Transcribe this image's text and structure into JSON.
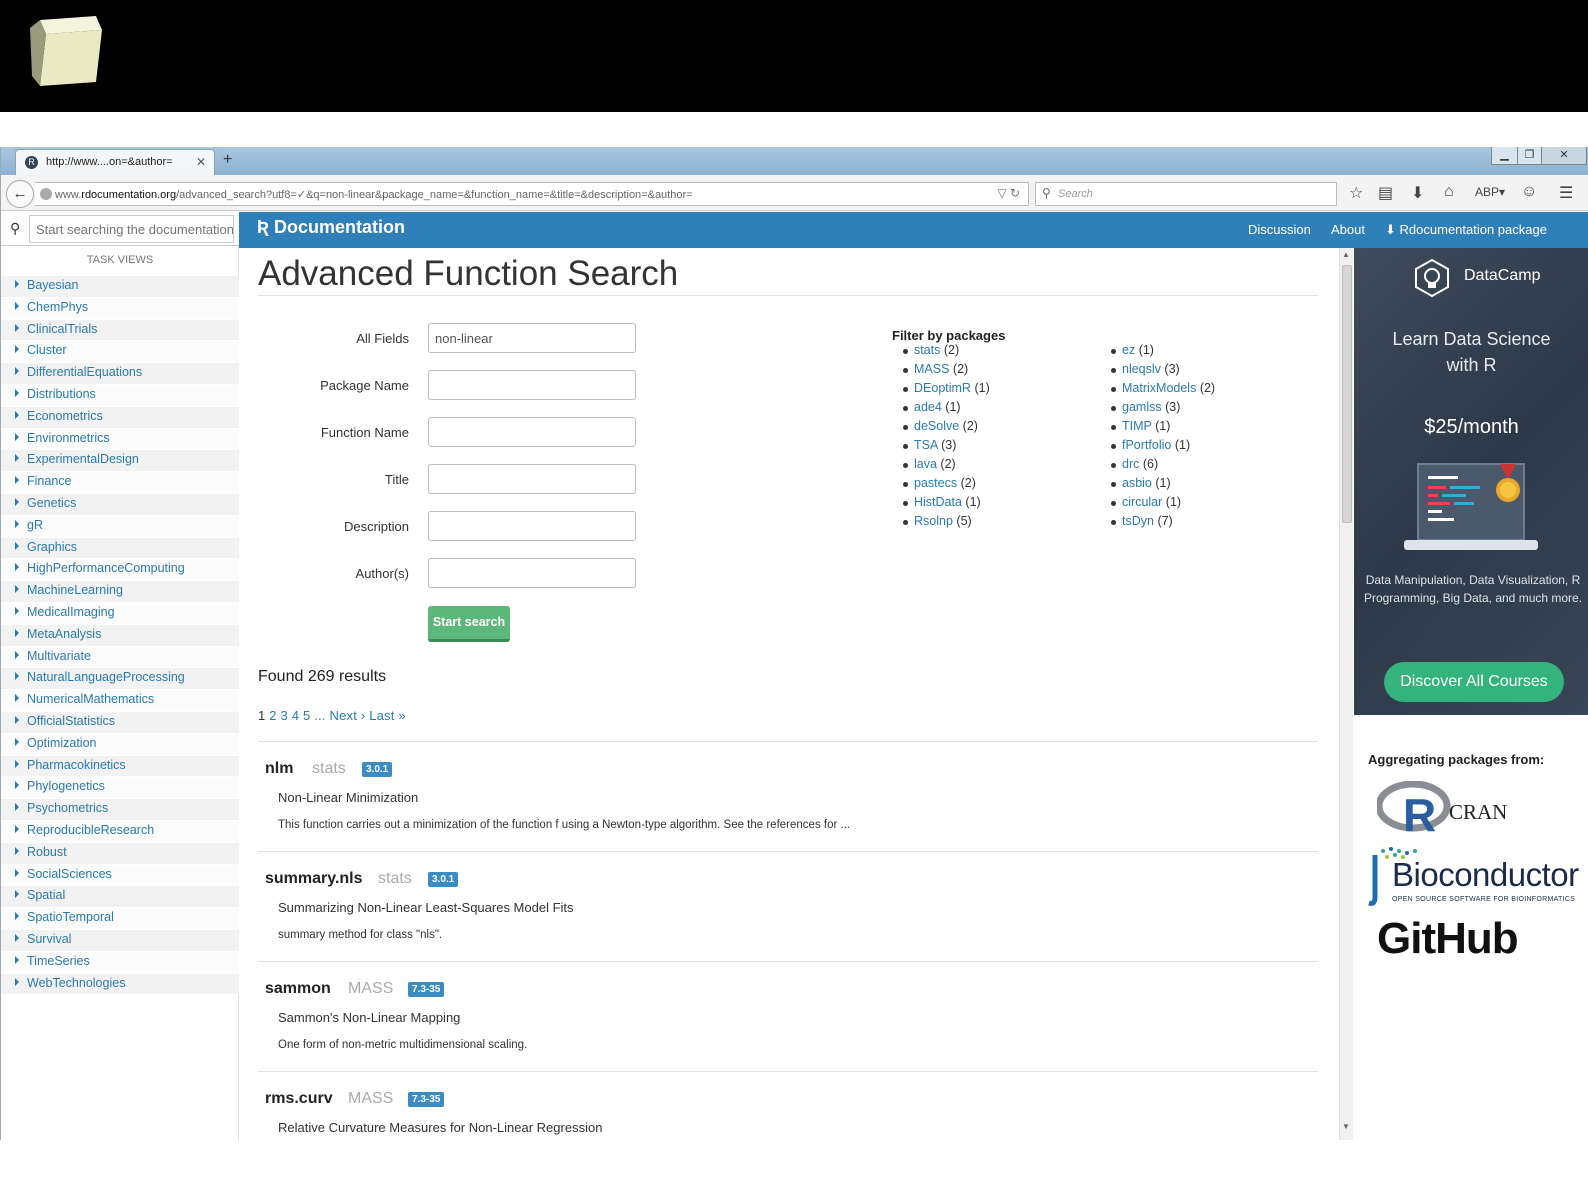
{
  "browser": {
    "tab_title": "http://www....on=&author=",
    "url_domain": "www.rdocumentation.org",
    "url_prefix": "www.",
    "url_domain_main": "rdocumentation.org",
    "url_path": "/advanced_search?utf8=✓&q=non-linear&package_name=&function_name=&title=&description=&author=",
    "search_placeholder": "Search"
  },
  "sidebar": {
    "search_placeholder": "Start searching the documentation",
    "heading": "TASK VIEWS",
    "items": [
      "Bayesian",
      "ChemPhys",
      "ClinicalTrials",
      "Cluster",
      "DifferentialEquations",
      "Distributions",
      "Econometrics",
      "Environmetrics",
      "ExperimentalDesign",
      "Finance",
      "Genetics",
      "gR",
      "Graphics",
      "HighPerformanceComputing",
      "MachineLearning",
      "MedicalImaging",
      "MetaAnalysis",
      "Multivariate",
      "NaturalLanguageProcessing",
      "NumericalMathematics",
      "OfficialStatistics",
      "Optimization",
      "Pharmacokinetics",
      "Phylogenetics",
      "Psychometrics",
      "ReproducibleResearch",
      "Robust",
      "SocialSciences",
      "Spatial",
      "SpatioTemporal",
      "Survival",
      "TimeSeries",
      "WebTechnologies"
    ]
  },
  "header": {
    "logo_text": "Documentation",
    "nav": {
      "discussion": "Discussion",
      "about": "About",
      "package": "Rdocumentation package"
    }
  },
  "form": {
    "title": "Advanced Function Search",
    "fields": [
      {
        "label": "All Fields",
        "value": "non-linear"
      },
      {
        "label": "Package Name",
        "value": ""
      },
      {
        "label": "Function Name",
        "value": ""
      },
      {
        "label": "Title",
        "value": ""
      },
      {
        "label": "Description",
        "value": ""
      },
      {
        "label": "Author(s)",
        "value": ""
      }
    ],
    "submit": "Start search"
  },
  "filter": {
    "heading": "Filter by packages",
    "col1": [
      {
        "name": "stats",
        "count": "(2)"
      },
      {
        "name": "MASS",
        "count": "(2)"
      },
      {
        "name": "DEoptimR",
        "count": "(1)"
      },
      {
        "name": "ade4",
        "count": "(1)"
      },
      {
        "name": "deSolve",
        "count": "(2)"
      },
      {
        "name": "TSA",
        "count": "(3)"
      },
      {
        "name": "lava",
        "count": "(2)"
      },
      {
        "name": "pastecs",
        "count": "(2)"
      },
      {
        "name": "HistData",
        "count": "(1)"
      },
      {
        "name": "Rsolnp",
        "count": "(5)"
      }
    ],
    "col2": [
      {
        "name": "ez",
        "count": "(1)"
      },
      {
        "name": "nleqslv",
        "count": "(3)"
      },
      {
        "name": "MatrixModels",
        "count": "(2)"
      },
      {
        "name": "gamlss",
        "count": "(3)"
      },
      {
        "name": "TIMP",
        "count": "(1)"
      },
      {
        "name": "fPortfolio",
        "count": "(1)"
      },
      {
        "name": "drc",
        "count": "(6)"
      },
      {
        "name": "asbio",
        "count": "(1)"
      },
      {
        "name": "circular",
        "count": "(1)"
      },
      {
        "name": "tsDyn",
        "count": "(7)"
      }
    ]
  },
  "results": {
    "found": "Found 269 results",
    "pager": {
      "pages": [
        "1",
        "2",
        "3",
        "4",
        "5"
      ],
      "ellipsis": "...",
      "next": "Next ›",
      "last": "Last »"
    },
    "items": [
      {
        "name": "nlm",
        "package": "stats",
        "version": "3.0.1",
        "title": "Non-Linear Minimization",
        "desc": "This function carries out a minimization of the function f using a Newton-type algorithm. See the references for ..."
      },
      {
        "name": "summary.nls",
        "package": "stats",
        "version": "3.0.1",
        "title": "Summarizing Non-Linear Least-Squares Model Fits",
        "desc": "summary method for class \"nls\"."
      },
      {
        "name": "sammon",
        "package": "MASS",
        "version": "7.3-35",
        "title": "Sammon's Non-Linear Mapping",
        "desc": "One form of non-metric multidimensional scaling."
      },
      {
        "name": "rms.curv",
        "package": "MASS",
        "version": "7.3-35",
        "title": "Relative Curvature Measures for Non-Linear Regression",
        "desc": ""
      }
    ]
  },
  "ad": {
    "brand": "DataCamp",
    "title_line1": "Learn Data Science",
    "title_line2": "with R",
    "price": "$25/month",
    "subtitle": "Data Manipulation, Data Visualization, R Programming, Big Data, and much more.",
    "button": "Discover All Courses"
  },
  "aggregating": {
    "heading": "Aggregating packages from:",
    "cran": "CRAN",
    "bioconductor": "Bioconductor",
    "bioconductor_tagline": "OPEN SOURCE SOFTWARE FOR BIOINFORMATICS",
    "github": "GitHub"
  }
}
